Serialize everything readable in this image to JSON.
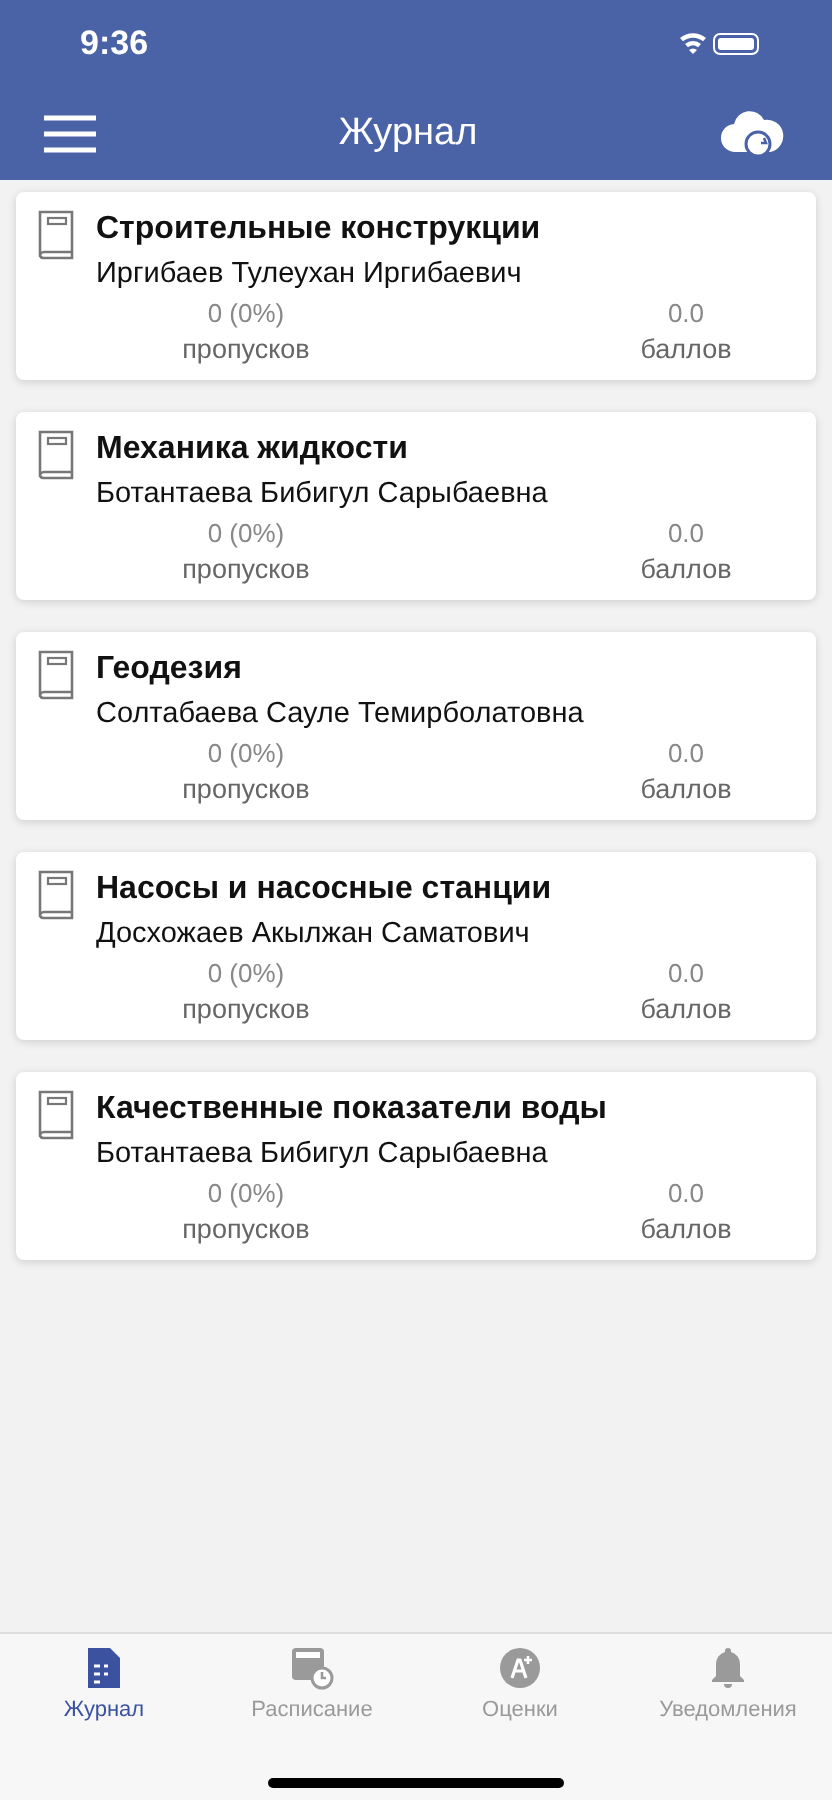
{
  "status_bar": {
    "time": "9:36"
  },
  "header": {
    "title": "Журнал"
  },
  "courses": [
    {
      "title": "Строительные конструкции",
      "teacher": "Иргибаев Тулеухан Иргибаевич",
      "absences": "0 (0%)",
      "absences_label": "пропусков",
      "score": "0.0",
      "score_label": "баллов"
    },
    {
      "title": "Механика жидкости",
      "teacher": "Ботантаева Бибигул Сарыбаевна",
      "absences": "0 (0%)",
      "absences_label": "пропусков",
      "score": "0.0",
      "score_label": "баллов"
    },
    {
      "title": "Геодезия",
      "teacher": "Солтабаева Сауле Темирболатовна",
      "absences": "0 (0%)",
      "absences_label": "пропусков",
      "score": "0.0",
      "score_label": "баллов"
    },
    {
      "title": "Насосы и насосные станции",
      "teacher": "Досхожаев Акылжан Саматович",
      "absences": "0 (0%)",
      "absences_label": "пропусков",
      "score": "0.0",
      "score_label": "баллов"
    },
    {
      "title": "Качественные показатели воды",
      "teacher": "Ботантаева Бибигул Сарыбаевна",
      "absences": "0 (0%)",
      "absences_label": "пропусков",
      "score": "0.0",
      "score_label": "баллов"
    }
  ],
  "tabs": [
    {
      "kind": "journal",
      "label": "Журнал",
      "selected": true
    },
    {
      "kind": "schedule",
      "label": "Расписание",
      "selected": false
    },
    {
      "kind": "grades",
      "label": "Оценки",
      "selected": false
    },
    {
      "kind": "notifications",
      "label": "Уведомления",
      "selected": false
    }
  ]
}
